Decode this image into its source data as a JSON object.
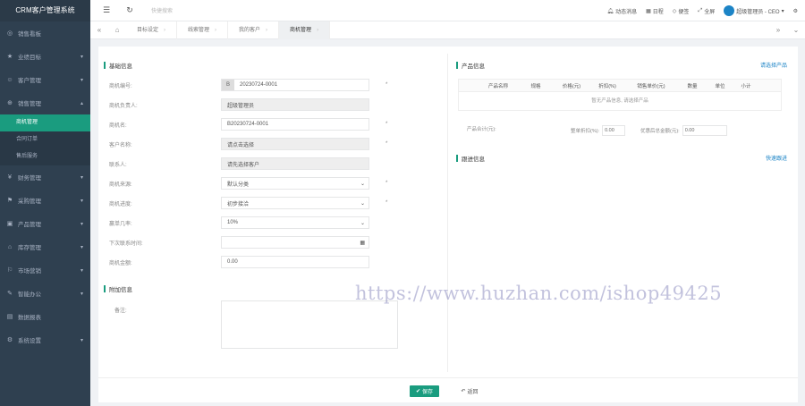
{
  "app": {
    "title": "CRM客户管理系统"
  },
  "sidebar": {
    "items": [
      {
        "label": "销售看板",
        "icon": "dashboard-icon",
        "caret": ""
      },
      {
        "label": "业绩目标",
        "icon": "star-icon",
        "caret": "▾"
      },
      {
        "label": "客户管理",
        "icon": "user-icon",
        "caret": "▾"
      },
      {
        "label": "销售管理",
        "icon": "cart-icon",
        "caret": "▴"
      },
      {
        "label": "财务管理",
        "icon": "money-icon",
        "caret": "▾"
      },
      {
        "label": "采购管理",
        "icon": "truck-icon",
        "caret": "▾"
      },
      {
        "label": "产品管理",
        "icon": "box-icon",
        "caret": "▾"
      },
      {
        "label": "库存管理",
        "icon": "warehouse-icon",
        "caret": "▾"
      },
      {
        "label": "市场营销",
        "icon": "flag-icon",
        "caret": "▾"
      },
      {
        "label": "智能办公",
        "icon": "office-icon",
        "caret": "▾"
      },
      {
        "label": "数据报表",
        "icon": "chart-icon",
        "caret": ""
      },
      {
        "label": "系统设置",
        "icon": "gear-icon",
        "caret": "▾"
      }
    ],
    "sub_items": [
      "商机管理",
      "合同订单",
      "售后服务"
    ]
  },
  "topbar": {
    "search_placeholder": "快捷搜索",
    "notifications": "动态消息",
    "schedule": "日程",
    "notes": "便签",
    "fullscreen": "全屏",
    "user": "超级管理员 - CEO"
  },
  "tabs": [
    "目标设定",
    "线索管理",
    "我的客户",
    "商机管理"
  ],
  "form": {
    "section_basic": "基础信息",
    "fields": [
      {
        "label": "商机编号:",
        "value": "20230724-0001",
        "readonly": false,
        "required": "*",
        "prefix": "B"
      },
      {
        "label": "商机负责人:",
        "value": "超级管理员",
        "readonly": true,
        "required": "",
        "prefix": ""
      },
      {
        "label": "商机名:",
        "value": "B20230724-0001",
        "readonly": false,
        "required": "*",
        "prefix": ""
      },
      {
        "label": "客户名称:",
        "value": "请点击选择",
        "readonly": true,
        "required": "*",
        "prefix": ""
      },
      {
        "label": "联系人:",
        "value": "请先选择客户",
        "readonly": true,
        "required": "",
        "prefix": ""
      },
      {
        "label": "商机来源:",
        "value": "默认分类",
        "readonly": false,
        "required": "*",
        "prefix": "",
        "select": true
      },
      {
        "label": "商机进度:",
        "value": "初步接洽",
        "readonly": false,
        "required": "*",
        "prefix": "",
        "select": true
      },
      {
        "label": "赢单几率:",
        "value": "10%",
        "readonly": false,
        "required": "",
        "prefix": "",
        "select": true
      },
      {
        "label": "下次联系时间:",
        "value": "",
        "readonly": false,
        "required": "",
        "prefix": "",
        "calendar": true
      },
      {
        "label": "商机金额:",
        "value": "0.00",
        "readonly": false,
        "required": "",
        "prefix": ""
      }
    ],
    "section_extra": "附加信息",
    "remark_label": "备注:"
  },
  "products": {
    "section": "产品信息",
    "select_link": "请选择产品",
    "columns": [
      "产品名称",
      "规格",
      "价格(元)",
      "折扣(%)",
      "销售单价(元)",
      "数量",
      "单位",
      "小计"
    ],
    "empty": "暂无产品信息, 请选择产品",
    "total_label": "产品合计(元):",
    "total_value": "",
    "discount_label": "整单折扣(%):",
    "discount_value": "0.00",
    "final_label": "优惠后总金额(元):",
    "final_value": "0.00"
  },
  "followup": {
    "section": "跟进信息",
    "link": "快速跟进"
  },
  "footer": {
    "save": "保存",
    "back": "返回"
  },
  "watermark": "https://www.huzhan.com/ishop49425",
  "colors": {
    "accent": "#1a9c7f",
    "sidebar": "#2f4050",
    "link": "#1c84c6"
  }
}
